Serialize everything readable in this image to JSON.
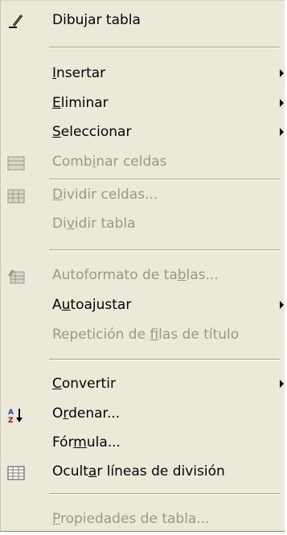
{
  "menu": {
    "items": [
      {
        "name": "dibujar-tabla",
        "label": "Dibujar tabla",
        "icon": "pencil-icon",
        "enabled": true
      },
      {
        "name": "insertar",
        "label": "Insertar",
        "underline": "I",
        "enabled": true,
        "submenu": true
      },
      {
        "name": "eliminar",
        "label": "Eliminar",
        "underline": "E",
        "enabled": true,
        "submenu": true
      },
      {
        "name": "seleccionar",
        "label": "Seleccionar",
        "underline": "S",
        "enabled": true,
        "submenu": true
      },
      {
        "name": "combinar-celdas",
        "label": "Combinar celdas",
        "underline": "i",
        "enabled": false,
        "icon": "merge-cells-icon"
      },
      {
        "name": "dividir-celdas",
        "label": "Dividir celdas...",
        "underline": "D",
        "enabled": false,
        "icon": "split-cells-icon"
      },
      {
        "name": "dividir-tabla",
        "label": "Dividir tabla",
        "underline": "v",
        "enabled": false
      },
      {
        "name": "autoformato-de-tablas",
        "label": "Autoformato de tablas...",
        "underline": "b",
        "enabled": false,
        "icon": "autoformat-icon"
      },
      {
        "name": "autoajustar",
        "label": "Autoajustar",
        "underline": "u",
        "enabled": true,
        "submenu": true
      },
      {
        "name": "repeticion-de-filas-de-titulo",
        "label": "Repetición de filas de título",
        "underline": "f",
        "enabled": false
      },
      {
        "name": "convertir",
        "label": "Convertir",
        "underline": "C",
        "enabled": true,
        "submenu": true
      },
      {
        "name": "ordenar",
        "label": "Ordenar...",
        "underline": "r",
        "enabled": true,
        "icon": "sort-az-icon"
      },
      {
        "name": "formula",
        "label": "Fórmula...",
        "underline": "m",
        "enabled": true
      },
      {
        "name": "ocultar-lineas-de-division",
        "label": "Ocultar líneas de división",
        "underline": "a",
        "enabled": true,
        "icon": "gridlines-icon"
      },
      {
        "name": "propiedades-de-tabla",
        "label": "Propiedades de tabla...",
        "underline": "P",
        "enabled": false
      }
    ]
  },
  "colors": {
    "menu_bg": "#ece9d8",
    "disabled_text": "#9a978c",
    "separator": "#a7a497"
  }
}
